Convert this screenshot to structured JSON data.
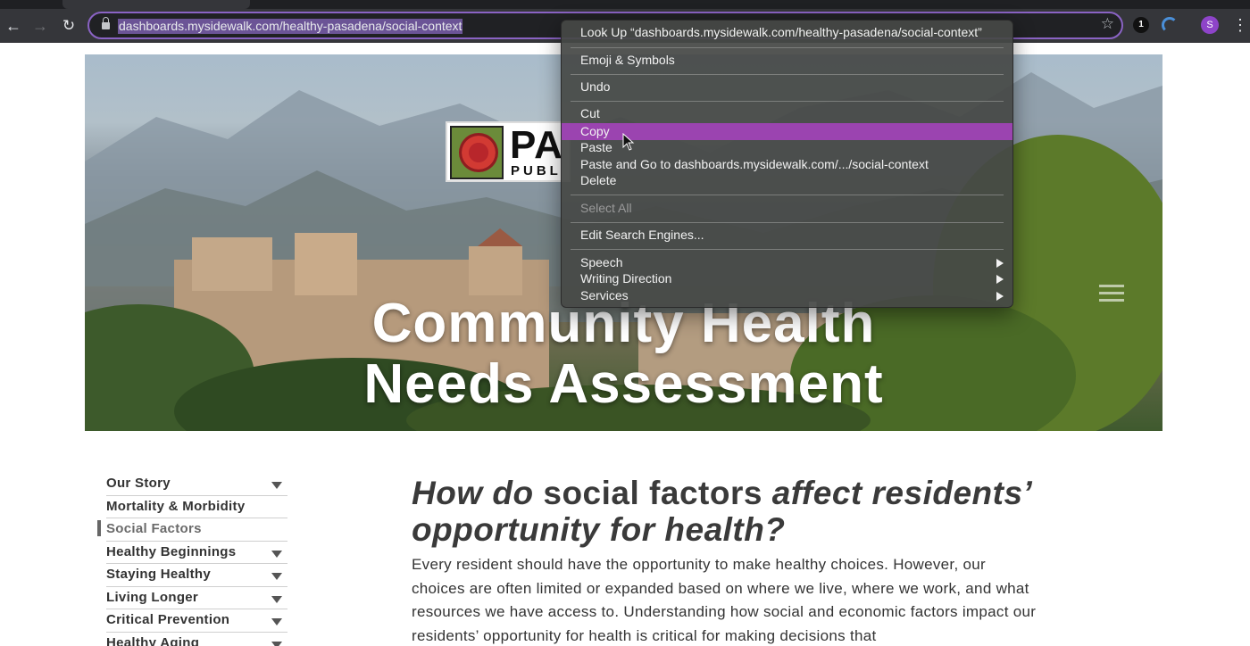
{
  "browser": {
    "url": "dashboards.mysidewalk.com/healthy-pasadena/social-context",
    "extension_badge": "1",
    "profile_initial": "S"
  },
  "hero": {
    "logo_text_large": "PA",
    "logo_text_small": "PUBL",
    "title_line1": "Community Health",
    "title_line2": "Needs Assessment"
  },
  "context_menu": {
    "items": [
      {
        "label": "Look Up “dashboards.mysidewalk.com/healthy-pasadena/social-context”",
        "state": "normal"
      },
      {
        "label": "Emoji & Symbols",
        "state": "normal"
      },
      {
        "label": "Undo",
        "state": "normal"
      },
      {
        "label": "Cut",
        "state": "normal"
      },
      {
        "label": "Copy",
        "state": "selected"
      },
      {
        "label": "Paste",
        "state": "normal"
      },
      {
        "label": "Paste and Go to dashboards.mysidewalk.com/.../social-context",
        "state": "normal"
      },
      {
        "label": "Delete",
        "state": "normal"
      },
      {
        "label": "Select All",
        "state": "disabled"
      },
      {
        "label": "Edit Search Engines...",
        "state": "normal"
      },
      {
        "label": "Speech",
        "state": "submenu"
      },
      {
        "label": "Writing Direction",
        "state": "submenu"
      },
      {
        "label": "Services",
        "state": "submenu"
      }
    ]
  },
  "sidebar": {
    "items": [
      {
        "label": "Our Story",
        "expandable": true,
        "active": false
      },
      {
        "label": "Mortality & Morbidity",
        "expandable": false,
        "active": false
      },
      {
        "label": "Social Factors",
        "expandable": false,
        "active": true
      },
      {
        "label": "Healthy Beginnings",
        "expandable": true,
        "active": false
      },
      {
        "label": "Staying Healthy",
        "expandable": true,
        "active": false
      },
      {
        "label": "Living Longer",
        "expandable": true,
        "active": false
      },
      {
        "label": "Critical Prevention",
        "expandable": true,
        "active": false
      },
      {
        "label": "Healthy Aging",
        "expandable": true,
        "active": false
      }
    ]
  },
  "main": {
    "heading_part1": "How do",
    "heading_part2": " social factors ",
    "heading_part3": "affect residents’ opportunity for health?",
    "body": "Every resident should have the opportunity to make healthy choices. However, our choices are often limited or expanded based on where we live, where we work, and what resources we have access to. Understanding how social and economic factors impact our residents’ opportunity for health is critical for making decisions that"
  },
  "colors": {
    "menu_highlight": "#9b44b0",
    "omnibox_focus": "#8a63c4",
    "url_selection": "#6b5496"
  }
}
